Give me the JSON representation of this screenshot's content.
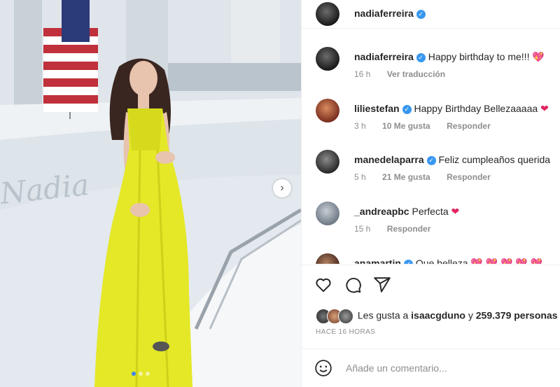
{
  "post": {
    "username": "nadiaferreira",
    "photo_name_on_boat": "Nadia"
  },
  "comments": [
    {
      "username": "nadiaferreira",
      "verified": true,
      "text": "Happy birthday to me!!!",
      "emoji": "💖",
      "time": "16 h",
      "likes": "",
      "action": "Ver traducción"
    },
    {
      "username": "liliestefan",
      "verified": true,
      "text": "Happy Birthday Bellezaaaaa",
      "emoji": "❤",
      "time": "3 h",
      "likes": "10 Me gusta",
      "action": "Responder"
    },
    {
      "username": "manedelaparra",
      "verified": true,
      "text": "Feliz cumpleaños querida",
      "emoji": "",
      "time": "5 h",
      "likes": "21 Me gusta",
      "action": "Responder"
    },
    {
      "username": "_andreapbc",
      "verified": false,
      "text": "Perfecta",
      "emoji": "❤",
      "time": "15 h",
      "likes": "",
      "action": "Responder"
    },
    {
      "username": "anamartin",
      "verified": true,
      "text": "Que belleza",
      "emoji": "💖 💖 💖 💖 💖",
      "time": "",
      "likes": "",
      "action": ""
    }
  ],
  "likes": {
    "prefix": "Les gusta a",
    "user": "isaacgduno",
    "connector": "y",
    "count": "259.379 personas"
  },
  "posted_time": "HACE 16 HORAS",
  "add_comment_placeholder": "Añade un comentario...",
  "colors": {
    "verified": "#3897f0",
    "heart": "#e0245e",
    "dress": "#e4e827"
  }
}
